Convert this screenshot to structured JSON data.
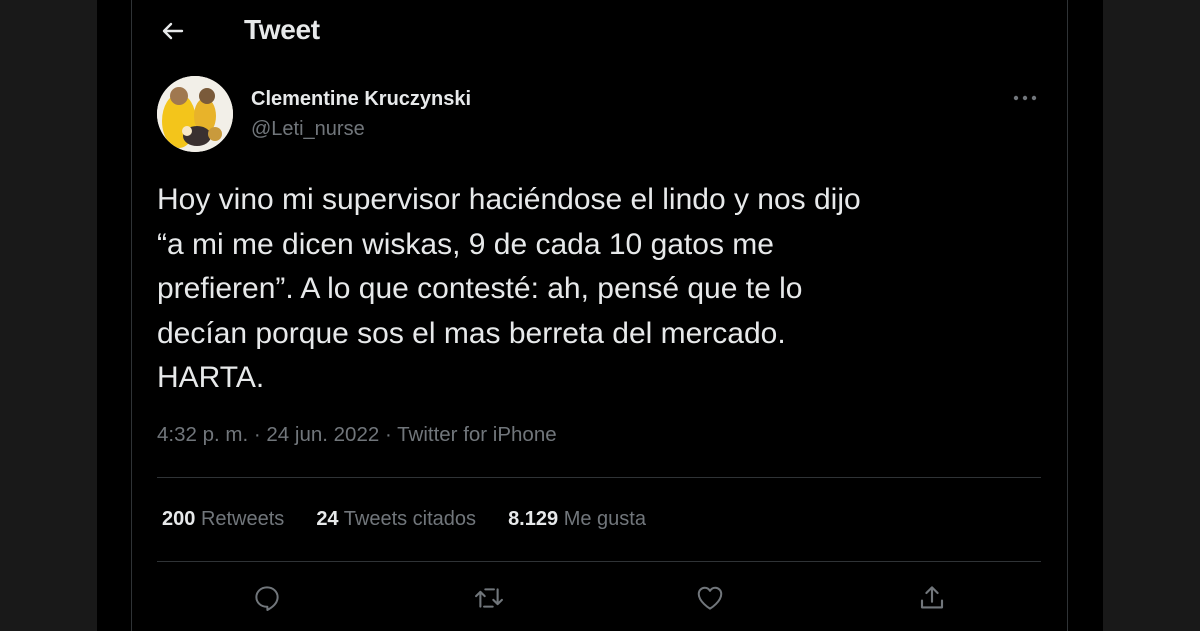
{
  "header": {
    "title": "Tweet",
    "back_icon": "arrow-left-icon"
  },
  "author": {
    "name": "Clementine Kruczynski",
    "handle": "@Leti_nurse",
    "avatar_colors": [
      "#f3c51b",
      "#f2efe8",
      "#8a6a4a"
    ]
  },
  "tweet": {
    "text": "Hoy vino mi supervisor haciéndose el lindo y nos dijo\n“a mi me dicen wiskas, 9 de cada 10 gatos me\nprefieren”. A lo que contesté: ah, pensé que te lo\ndecían porque sos el mas berreta del mercado.\nHARTA.",
    "time": "4:32 p. m.",
    "date": "24 jun. 2022",
    "source": "Twitter for iPhone",
    "separator": "·"
  },
  "stats": {
    "retweets_count": "200",
    "retweets_label": "Retweets",
    "quotes_count": "24",
    "quotes_label": "Tweets citados",
    "likes_count": "8.129",
    "likes_label": "Me gusta"
  },
  "actions": [
    "reply-icon",
    "retweet-icon",
    "like-icon",
    "share-icon"
  ],
  "colors": {
    "background": "#000000",
    "outer": "#191919",
    "text": "#e7e9ea",
    "secondary": "#71767b",
    "border": "#2f3336"
  }
}
